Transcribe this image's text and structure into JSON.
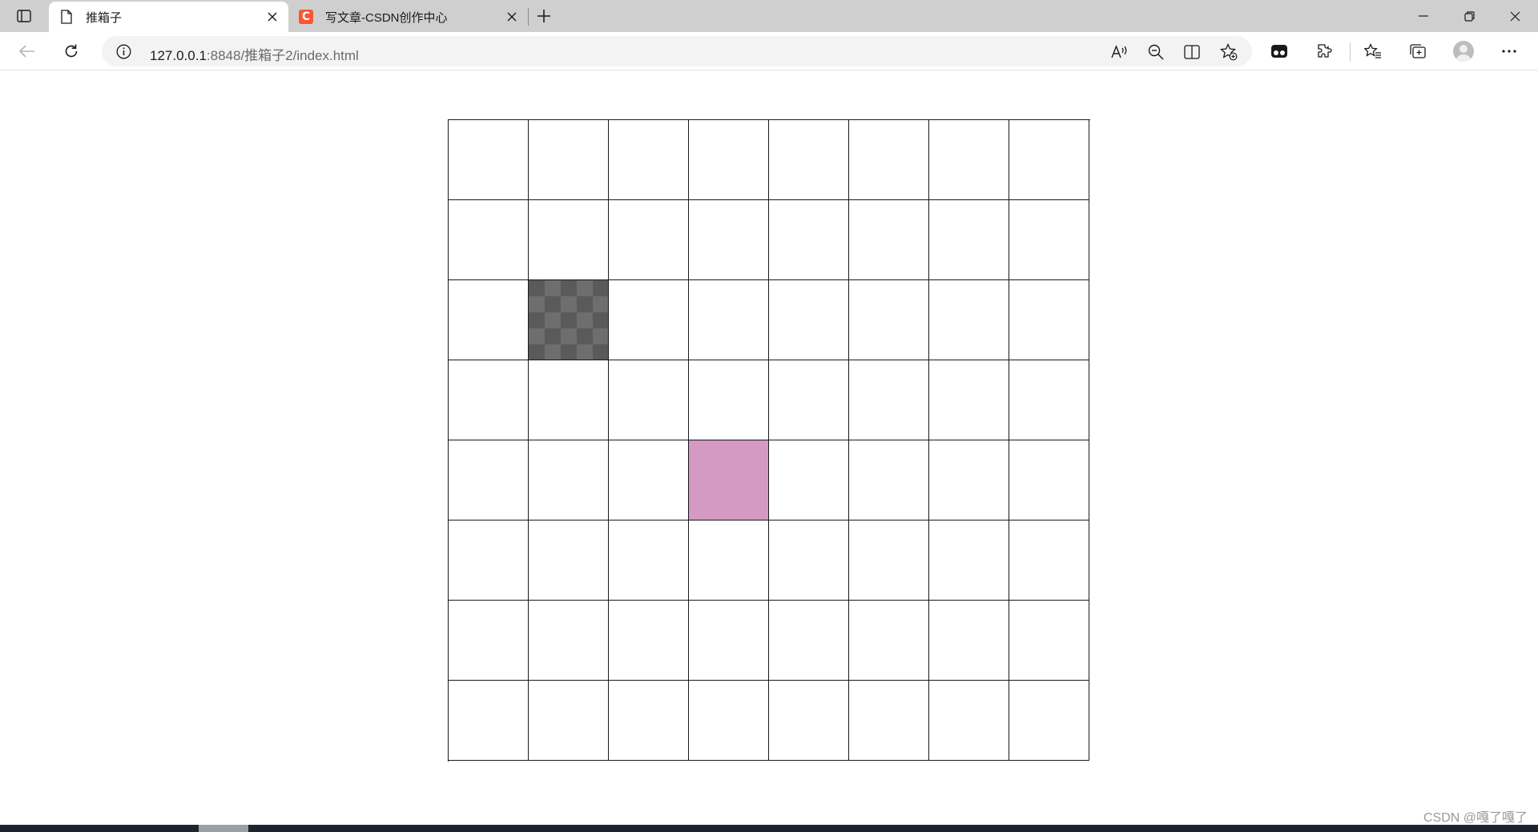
{
  "browser": {
    "tabs": [
      {
        "title": "推箱子",
        "active": true,
        "favicon": "page-icon"
      },
      {
        "title": "写文章-CSDN创作中心",
        "active": false,
        "favicon": "csdn-icon"
      }
    ],
    "address": {
      "host": "127.0.0.1",
      "rest": ":8848/推箱子2/index.html"
    },
    "csdn_favicon_letter": "C"
  },
  "game": {
    "rows": 8,
    "cols": 8,
    "cells": [
      [
        "empty",
        "empty",
        "empty",
        "empty",
        "empty",
        "empty",
        "empty",
        "empty"
      ],
      [
        "empty",
        "empty",
        "empty",
        "empty",
        "empty",
        "empty",
        "empty",
        "empty"
      ],
      [
        "empty",
        "wall",
        "empty",
        "empty",
        "empty",
        "empty",
        "empty",
        "empty"
      ],
      [
        "empty",
        "empty",
        "empty",
        "empty",
        "empty",
        "empty",
        "empty",
        "empty"
      ],
      [
        "empty",
        "empty",
        "empty",
        "box",
        "empty",
        "empty",
        "empty",
        "empty"
      ],
      [
        "empty",
        "empty",
        "empty",
        "empty",
        "empty",
        "empty",
        "empty",
        "empty"
      ],
      [
        "empty",
        "empty",
        "empty",
        "empty",
        "empty",
        "empty",
        "empty",
        "empty"
      ],
      [
        "empty",
        "empty",
        "empty",
        "empty",
        "empty",
        "empty",
        "empty",
        "empty"
      ]
    ],
    "colors": {
      "wall": "#5a5a5a",
      "box": "#d49ac3",
      "grid_line": "#1a1a1a"
    }
  },
  "watermark": "CSDN @嘎了嘎了"
}
